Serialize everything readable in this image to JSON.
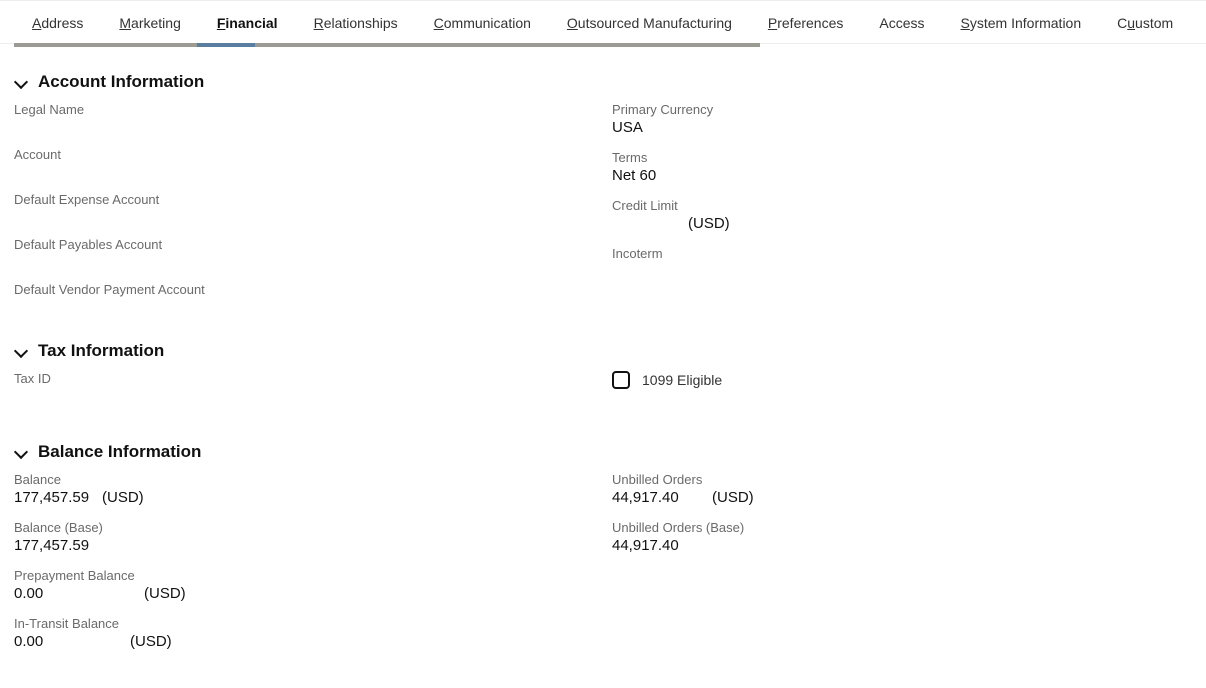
{
  "tabs": {
    "address": "ddress",
    "marketing": "arketing",
    "financial": "inancial",
    "relationships": "elationships",
    "communication": "ommunication",
    "outsourced": "utsourced Manufacturing",
    "preferences": "references",
    "access": "Access",
    "sysinfo": "ystem Information",
    "custom": "ustom"
  },
  "accountInfo": {
    "heading": "Account Information",
    "legalName_lbl": "Legal Name",
    "account_lbl": "Account",
    "defExp_lbl": "Default Expense Account",
    "defPay_lbl": "Default Payables Account",
    "defVend_lbl": "Default Vendor Payment Account",
    "primCur_lbl": "Primary Currency",
    "primCur_val": "USA",
    "terms_lbl": "Terms",
    "terms_val": "Net 60",
    "credit_lbl": "Credit Limit",
    "credit_cur": "(USD)",
    "incoterm_lbl": "Incoterm"
  },
  "taxInfo": {
    "heading": "Tax Information",
    "taxid_lbl": "Tax ID",
    "eligible_lbl": "1099 Eligible"
  },
  "balInfo": {
    "heading": "Balance Information",
    "balance_lbl": "Balance",
    "balance_val": "177,457.59",
    "balance_cur": "(USD)",
    "balanceBase_lbl": "Balance (Base)",
    "balanceBase_val": "177,457.59",
    "prepay_lbl": "Prepayment Balance",
    "prepay_val": "0.00",
    "prepay_cur": "(USD)",
    "intransit_lbl": "In-Transit Balance",
    "intransit_val": "0.00",
    "intransit_cur": "(USD)",
    "unbilled_lbl": "Unbilled Orders",
    "unbilled_val": "44,917.40",
    "unbilled_cur": "(USD)",
    "unbilledBase_lbl": "Unbilled Orders (Base)",
    "unbilledBase_val": "44,917.40"
  }
}
